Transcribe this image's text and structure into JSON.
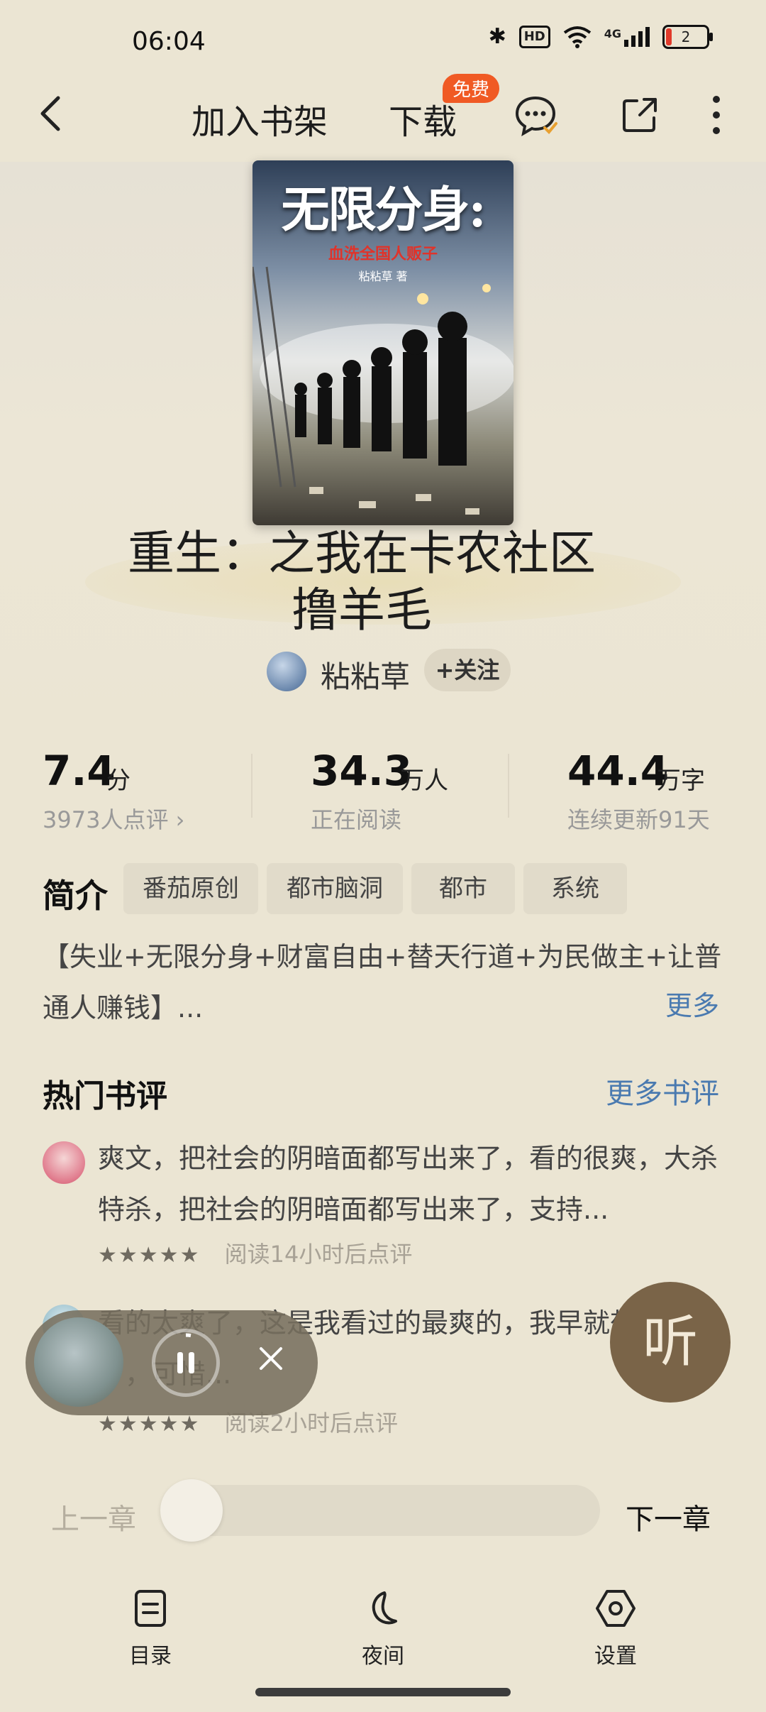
{
  "status_bar": {
    "time": "06:04",
    "hd": "HD",
    "network": "4G",
    "battery": "2"
  },
  "nav": {
    "add_shelf": "加入书架",
    "download": "下载",
    "free_badge": "免费"
  },
  "book": {
    "cover_title": "无限分身:",
    "cover_subtitle": "血洗全国人贩子",
    "cover_author": "粘粘草 著",
    "title_line1": "重生：之我在卡农社区",
    "title_line2": "撸羊毛",
    "author": "粘粘草",
    "follow": "+关注"
  },
  "stats": [
    {
      "value": "7.4",
      "unit": "分",
      "sub": "3973人点评 ›"
    },
    {
      "value": "34.3",
      "unit": "万人",
      "sub": "正在阅读"
    },
    {
      "value": "44.4",
      "unit": "万字",
      "sub": "连续更新91天"
    }
  ],
  "intro": {
    "label": "简介",
    "tags": [
      "番茄原创",
      "都市脑洞",
      "都市",
      "系统"
    ],
    "text": "【失业+无限分身+财富自由+替天行道+为民做主+让普通人赚钱】...",
    "more": "更多"
  },
  "reviews": {
    "title": "热门书评",
    "more": "更多书评",
    "items": [
      {
        "text": "爽文，把社会的阴暗面都写出来了，看的很爽，大杀特杀，把社会的阴暗面都写出来了，支持...",
        "stars": "★★★★★",
        "meta": "阅读14小时后点评"
      },
      {
        "text": "看的太爽了，这是我看过的最爽的，我早就想自己写了，可惜...",
        "stars": "★★★★★",
        "meta": "阅读2小时后点评"
      }
    ]
  },
  "player": {
    "listen": "听"
  },
  "chapter": {
    "prev": "上一章",
    "next": "下一章",
    "progress": 0
  },
  "bottom_bar": {
    "toc": "目录",
    "night": "夜间",
    "settings": "设置"
  }
}
